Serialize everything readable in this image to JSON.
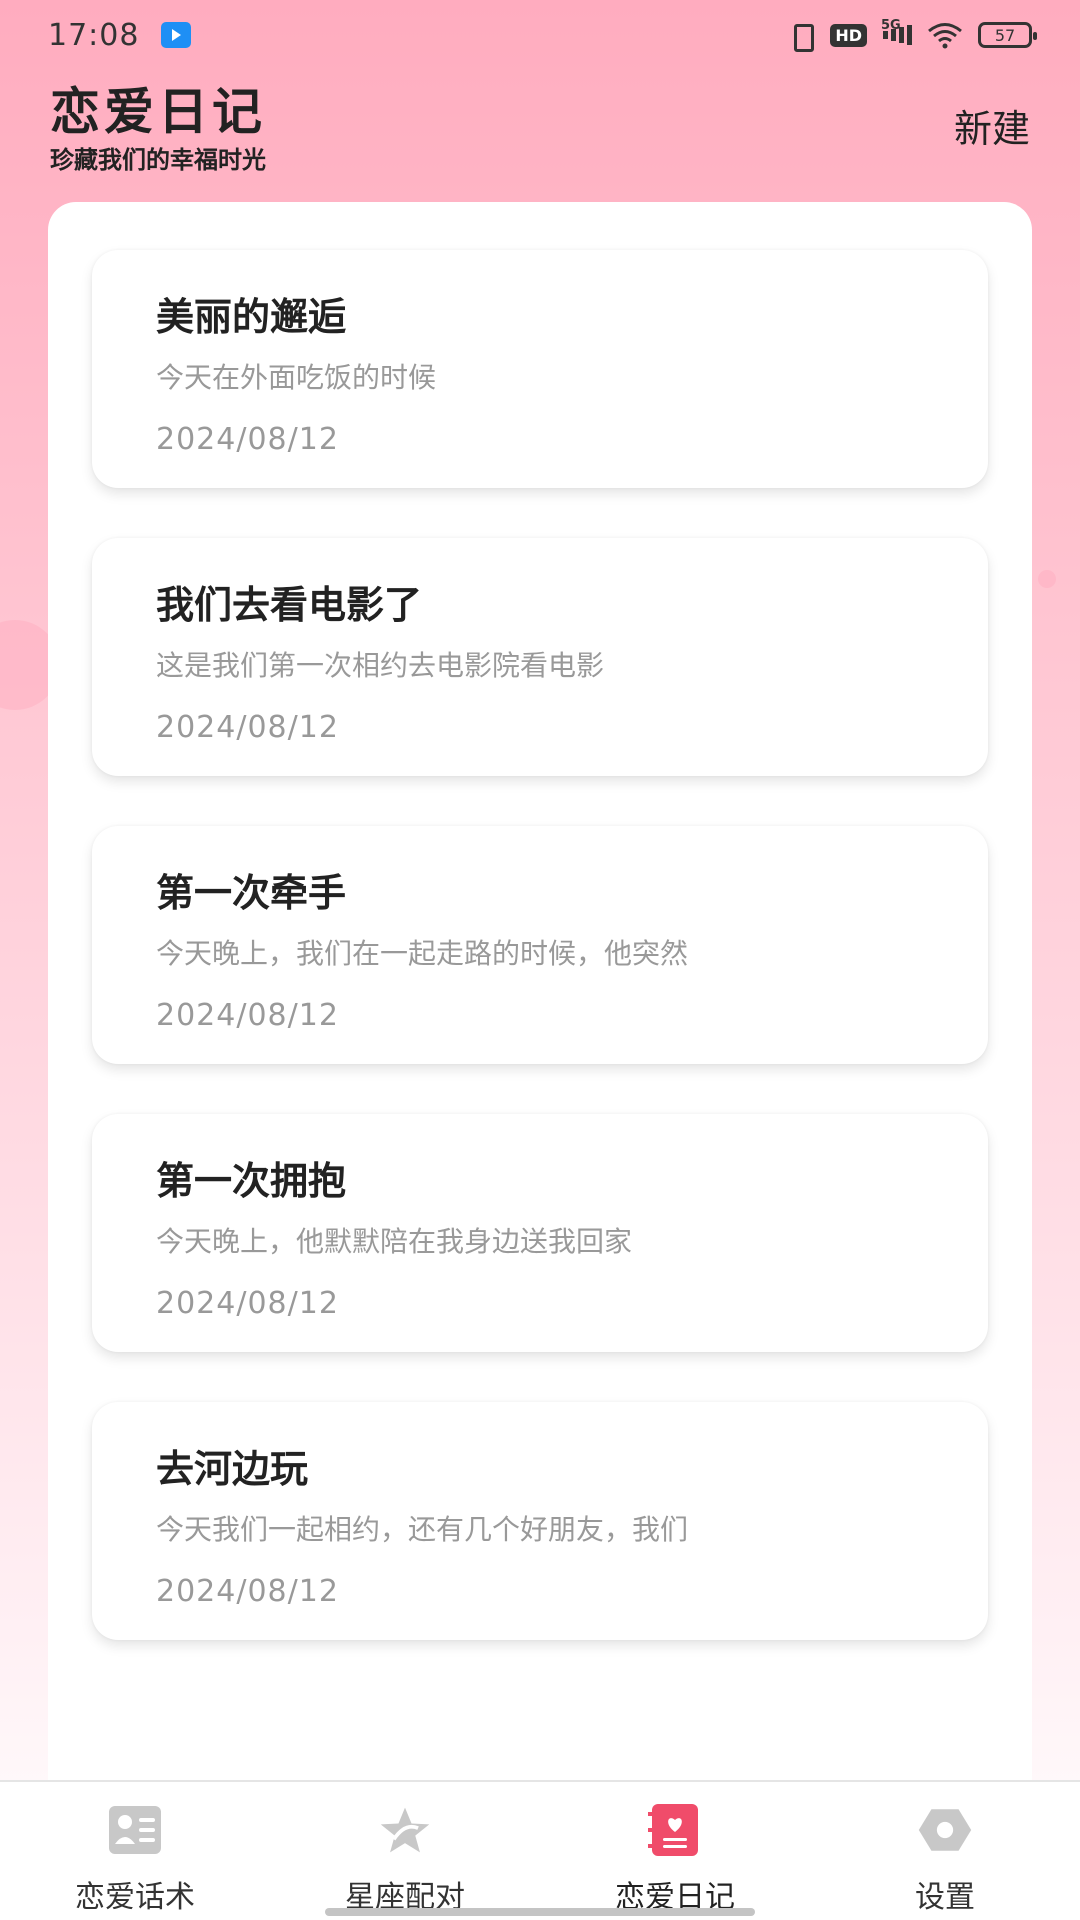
{
  "status_bar": {
    "time": "17:08",
    "network": "5G",
    "hd": "HD",
    "battery": "57"
  },
  "header": {
    "title": "恋爱日记",
    "subtitle": "珍藏我们的幸福时光",
    "new_label": "新建"
  },
  "entries": [
    {
      "title": "美丽的邂逅",
      "excerpt": "今天在外面吃饭的时候",
      "date": "2024/08/12"
    },
    {
      "title": "我们去看电影了",
      "excerpt": "这是我们第一次相约去电影院看电影",
      "date": "2024/08/12"
    },
    {
      "title": "第一次牵手",
      "excerpt": "今天晚上，我们在一起走路的时候，他突然",
      "date": "2024/08/12"
    },
    {
      "title": "第一次拥抱",
      "excerpt": "今天晚上，他默默陪在我身边送我回家",
      "date": "2024/08/12"
    },
    {
      "title": "去河边玩",
      "excerpt": "今天我们一起相约，还有几个好朋友，我们",
      "date": "2024/08/12"
    }
  ],
  "nav": {
    "items": [
      {
        "label": "恋爱话术",
        "icon": "chat-card-icon",
        "active": false
      },
      {
        "label": "星座配对",
        "icon": "star-icon",
        "active": false
      },
      {
        "label": "恋爱日记",
        "icon": "diary-heart-icon",
        "active": true
      },
      {
        "label": "设置",
        "icon": "settings-hexagon-icon",
        "active": false
      }
    ]
  },
  "colors": {
    "accent": "#f04c6a",
    "inactive_icon": "#c8c8c8",
    "background_top": "#ffacbf"
  }
}
